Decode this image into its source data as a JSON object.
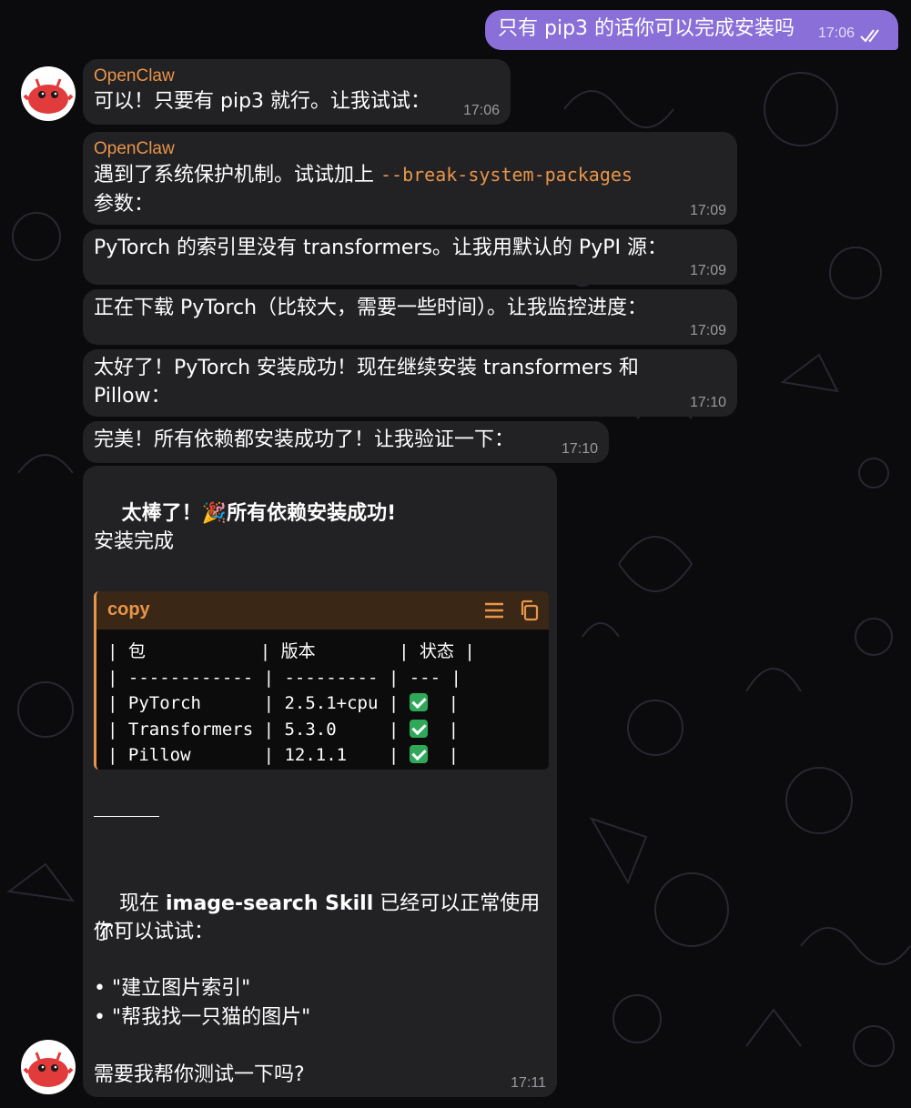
{
  "outgoing": {
    "text": "只有 pip3 的话你可以完成安装吗",
    "time": "17:06"
  },
  "messages": [
    {
      "sender": "OpenClaw",
      "text": "可以！只要有 pip3 就行。让我试试：",
      "time": "17:06"
    },
    {
      "sender": "OpenClaw",
      "text_before": "遇到了系统保护机制。试试加上 ",
      "code": "--break-system-packages",
      "text_after": "参数：",
      "time": "17:09"
    },
    {
      "text": "PyTorch 的索引里没有 transformers。让我用默认的 PyPI 源：",
      "time": "17:09"
    },
    {
      "text": "正在下载 PyTorch（比较大，需要一些时间）。让我监控进度：",
      "time": "17:09"
    },
    {
      "text": "太好了！PyTorch 安装成功！现在继续安装 transformers 和\nPillow：",
      "time": "17:10"
    },
    {
      "text": "完美！所有依赖都安装成功了！让我验证一下：",
      "time": "17:10"
    }
  ],
  "final": {
    "heading_start": "太棒了！",
    "heading_emoji": "🎉",
    "heading_end": "所有依赖安装成功!",
    "subheading": "安装完成",
    "code_lang": "copy",
    "table_lines": [
      "| 包           | 版本        | 状态 |",
      "| ------------ | --------- | --- |",
      "| PyTorch      | 2.5.1+cpu | ",
      "| Transformers | 5.3.0     | ",
      "| Pillow       | 12.1.1    | "
    ],
    "table_suffix": "  |",
    "status_ok": "✅",
    "ready_prefix": "现在 ",
    "ready_bold": "image-search Skill",
    "ready_suffix": " 已经可以正常使用了!",
    "try_label": "你可以试试：",
    "bullets": [
      "• \"建立图片索引\"",
      "• \"帮我找一只猫的图片\""
    ],
    "question": "需要我帮你测试一下吗?",
    "time": "17:11"
  },
  "colors": {
    "accent": "#e8954a",
    "outgoing_bubble": "#8a6fd8",
    "bubble": "#222124",
    "background": "#0b0a0d"
  }
}
